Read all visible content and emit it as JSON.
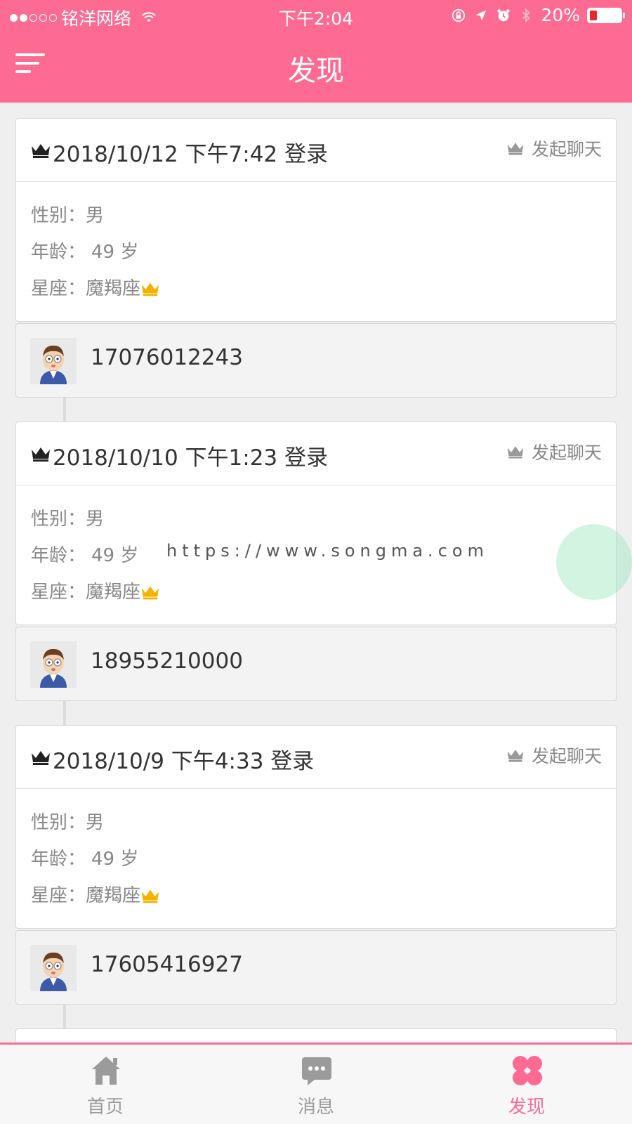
{
  "status_bar": {
    "carrier": "铭洋网络",
    "time": "下午2:04",
    "battery": "20%"
  },
  "nav": {
    "title": "发现"
  },
  "colors": {
    "brand": "#fd6b92",
    "crown_gold": "#f5b300"
  },
  "feed": [
    {
      "login_time": "2018/10/12 下午7:42 登录",
      "chat_label": "发起聊天",
      "gender_label": "性别：",
      "gender": "男",
      "age_label": "年龄：",
      "age": "49 岁",
      "sign_label": "星座：",
      "sign": "魔羯座",
      "phone": "17076012243"
    },
    {
      "login_time": "2018/10/10 下午1:23 登录",
      "chat_label": "发起聊天",
      "gender_label": "性别：",
      "gender": "男",
      "age_label": "年龄：",
      "age": "49 岁",
      "sign_label": "星座：",
      "sign": "魔羯座",
      "phone": "18955210000"
    },
    {
      "login_time": "2018/10/9 下午4:33 登录",
      "chat_label": "发起聊天",
      "gender_label": "性别：",
      "gender": "男",
      "age_label": "年龄：",
      "age": "49 岁",
      "sign_label": "星座：",
      "sign": "魔羯座",
      "phone": "17605416927"
    }
  ],
  "watermark": "https://www.songma.com",
  "tabs": [
    {
      "label": "首页",
      "icon": "home-icon"
    },
    {
      "label": "消息",
      "icon": "message-icon"
    },
    {
      "label": "发现",
      "icon": "discover-icon",
      "active": true
    }
  ]
}
